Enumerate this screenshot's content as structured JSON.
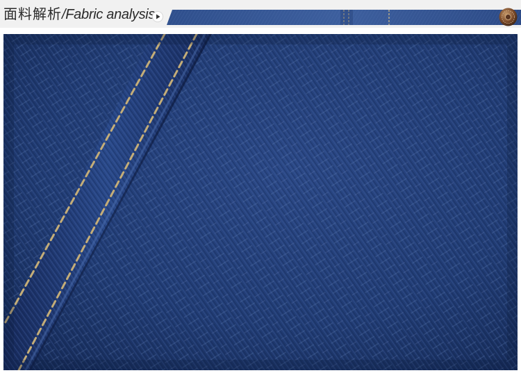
{
  "header": {
    "title_cn": "面料解析",
    "separator": "/",
    "title_en": "Fabric analysis"
  },
  "icons": {
    "play": "play-icon",
    "rivet": "rivet-icon"
  },
  "colors": {
    "header_bg": "#f1f1f1",
    "denim_dark": "#152a57",
    "denim_mid": "#24407a",
    "stitch": "#c4ad78"
  }
}
